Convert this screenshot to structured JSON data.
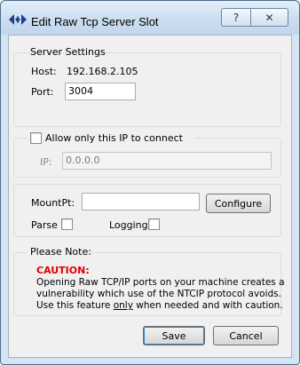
{
  "window": {
    "title": "Edit Raw Tcp Server Slot",
    "help_label": "?",
    "close_label": "✕"
  },
  "server_settings": {
    "legend": "Server Settings",
    "host_label": "Host:",
    "host_value": "192.168.2.105",
    "port_label": "Port:",
    "port_value": "3004"
  },
  "ip_filter": {
    "checkbox_label": "Allow only this IP to connect",
    "checked": false,
    "ip_label": "IP:",
    "ip_value": "0.0.0.0"
  },
  "mount": {
    "mountpt_label": "MountPt:",
    "mountpt_value": "",
    "configure_label": "Configure",
    "parse_label": "Parse",
    "logging_label": "Logging"
  },
  "note": {
    "legend": "Please Note:",
    "caution": "CAUTION:",
    "line1": "Opening Raw TCP/IP ports on your machine creates a",
    "line2": "vulnerability which use of the NTCIP protocol avoids.",
    "line3_prefix": "Use this feature ",
    "line3_underlined": "only",
    "line3_suffix": " when needed and with caution."
  },
  "buttons": {
    "save_label": "Save",
    "cancel_label": "Cancel"
  }
}
